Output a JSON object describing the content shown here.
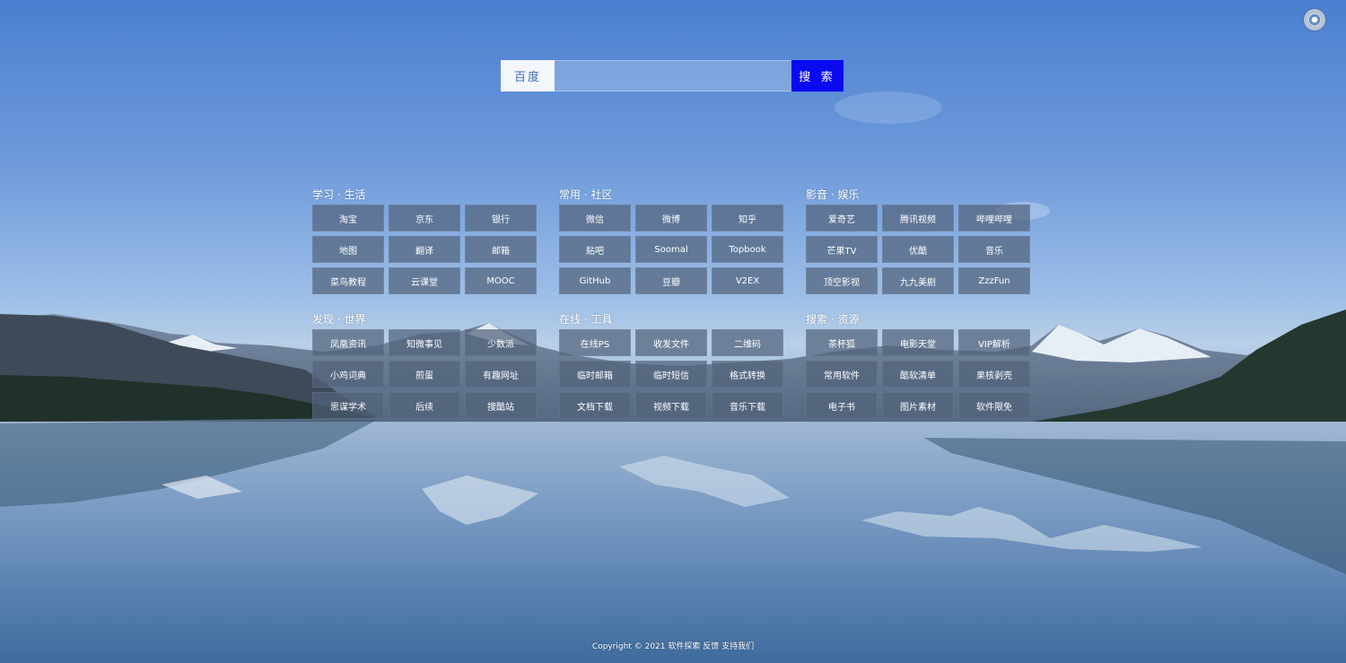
{
  "search": {
    "engine_label": "百度",
    "placeholder": "",
    "value": "",
    "submit_label": "搜 索"
  },
  "groups": [
    {
      "title": "学习 · 生活",
      "links": [
        "淘宝",
        "京东",
        "银行",
        "地图",
        "翻译",
        "邮箱",
        "菜鸟教程",
        "云课堂",
        "MOOC"
      ]
    },
    {
      "title": "常用 · 社区",
      "links": [
        "微信",
        "微博",
        "知乎",
        "贴吧",
        "Soomal",
        "Topbook",
        "GitHub",
        "豆瓣",
        "V2EX"
      ]
    },
    {
      "title": "影音 · 娱乐",
      "links": [
        "爱奇艺",
        "腾讯视频",
        "哔哩哔哩",
        "芒果TV",
        "优酷",
        "音乐",
        "顶空影视",
        "九九美剧",
        "ZzzFun"
      ]
    },
    {
      "title": "发现 · 世界",
      "links": [
        "凤凰资讯",
        "知微事见",
        "少数派",
        "小鸡词典",
        "煎蛋",
        "有趣网址",
        "思谋学术",
        "后续",
        "搜酷站"
      ]
    },
    {
      "title": "在线 · 工具",
      "links": [
        "在线PS",
        "收发文件",
        "二维码",
        "临时邮箱",
        "临时短信",
        "格式转换",
        "文档下载",
        "视频下载",
        "音乐下载"
      ]
    },
    {
      "title": "搜索 · 资源",
      "links": [
        "茶杯狐",
        "电影天堂",
        "VIP解析",
        "常用软件",
        "酷软清单",
        "果核剥壳",
        "电子书",
        "图片素材",
        "软件限免"
      ]
    }
  ],
  "footer": {
    "text": "Copyright © 2021 软件探索 反馈 支持我们"
  },
  "colors": {
    "accent": "#0a0af0",
    "tile_background": "#52627c",
    "engine_text": "#3e6fb6"
  },
  "icons": {
    "settings": "settings-icon"
  }
}
